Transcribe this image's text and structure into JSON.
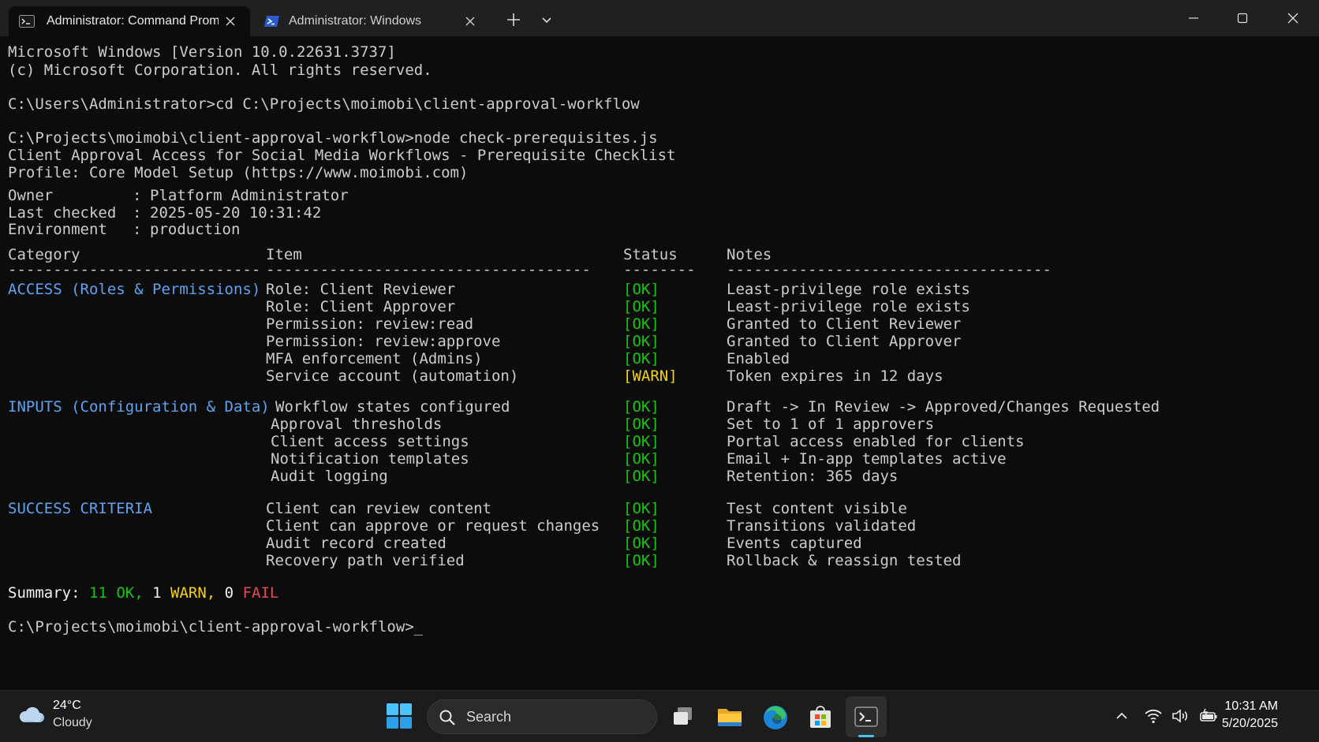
{
  "tabs": [
    {
      "title": "Administrator: Command Prompt"
    },
    {
      "title": "Administrator: Windows PowerShell"
    }
  ],
  "terminal": {
    "header_lines": [
      "Microsoft Windows [Version 10.0.22631.3737]",
      "(c) Microsoft Corporation. All rights reserved."
    ],
    "cd_command": "C:\\Users\\Administrator>cd C:\\Projects\\moimobi\\client-approval-workflow",
    "run_command": "C:\\Projects\\moimobi\\client-approval-workflow>node check-prerequisites.js",
    "report_title": "Client Approval Access for Social Media Workflows - Prerequisite Checklist",
    "profile": "Profile: Core Model Setup (https://www.moimobi.com)",
    "meta": [
      {
        "key": "Owner",
        "value": "Platform Administrator"
      },
      {
        "key": "Last checked",
        "value": "2025-05-20 10:31:42"
      },
      {
        "key": "Environment",
        "value": "production"
      }
    ],
    "columns": [
      "Category",
      "Item",
      "Status",
      "Notes"
    ],
    "separators": {
      "category": "----------------------------",
      "item": "------------------------------------",
      "status": "--------",
      "notes": "------------------------------------"
    },
    "sections": [
      {
        "category": "ACCESS (Roles & Permissions)",
        "rows": [
          {
            "item": "Role: Client Reviewer",
            "status": "[OK]",
            "notes": "Least-privilege role exists"
          },
          {
            "item": "Role: Client Approver",
            "status": "[OK]",
            "notes": "Least-privilege role exists"
          },
          {
            "item": "Permission: review:read",
            "status": "[OK]",
            "notes": "Granted to Client Reviewer"
          },
          {
            "item": "Permission: review:approve",
            "status": "[OK]",
            "notes": "Granted to Client Approver"
          },
          {
            "item": "MFA enforcement (Admins)",
            "status": "[OK]",
            "notes": "Enabled"
          },
          {
            "item": "Service account (automation)",
            "status": "[WARN]",
            "notes": "Token expires in 12 days"
          }
        ]
      },
      {
        "category": "INPUTS (Configuration & Data)",
        "rows": [
          {
            "item": "Workflow states configured",
            "status": "[OK]",
            "notes": "Draft -> In Review -> Approved/Changes Requested"
          },
          {
            "item": "Approval thresholds",
            "status": "[OK]",
            "notes": "Set to 1 of 1 approvers"
          },
          {
            "item": "Client access settings",
            "status": "[OK]",
            "notes": "Portal access enabled for clients"
          },
          {
            "item": "Notification templates",
            "status": "[OK]",
            "notes": "Email + In-app templates active"
          },
          {
            "item": "Audit logging",
            "status": "[OK]",
            "notes": "Retention: 365 days"
          }
        ]
      },
      {
        "category": "SUCCESS CRITERIA",
        "rows": [
          {
            "item": "Client can review content",
            "status": "[OK]",
            "notes": "Test content visible"
          },
          {
            "item": "Client can approve or request changes",
            "status": "[OK]",
            "notes": "Transitions validated"
          },
          {
            "item": "Audit record created",
            "status": "[OK]",
            "notes": "Events captured"
          },
          {
            "item": "Recovery path verified",
            "status": "[OK]",
            "notes": "Rollback & reassign tested"
          }
        ]
      }
    ],
    "summary": {
      "label": "Summary:",
      "ok_count": "11",
      "ok_label": "OK,",
      "warn_count": "1",
      "warn_label": "WARN,",
      "fail_count": "0",
      "fail_label": "FAIL"
    },
    "prompt": "C:\\Projects\\moimobi\\client-approval-workflow>_"
  },
  "taskbar": {
    "temperature": "24°C",
    "condition": "Cloudy",
    "search_placeholder": "Search",
    "time": "10:31 AM",
    "date": "5/20/2025"
  },
  "colors": {
    "ok": "#16c60c",
    "warn": "#f5d20f",
    "fail": "#e74856",
    "category": "#5ea3f2"
  }
}
